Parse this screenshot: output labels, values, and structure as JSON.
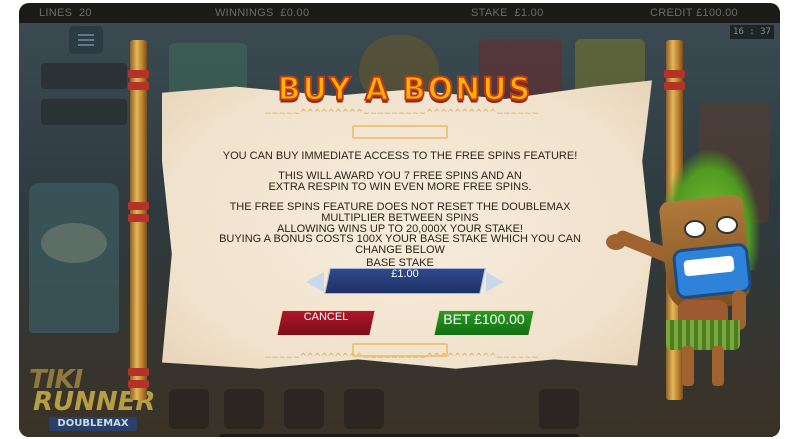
{
  "topbar": {
    "lines_label": "LINES",
    "lines_value": "20",
    "winnings_label": "WINNINGS",
    "winnings_value": "£0.00",
    "stake_label": "STAKE",
    "stake_value": "£1.00",
    "credit_label": "CREDIT",
    "credit_value": "£100.00",
    "clock": "16 : 37"
  },
  "dialog": {
    "title": "BUY A BONUS",
    "paragraphs": [
      [
        "YOU CAN BUY IMMEDIATE ACCESS TO THE FREE SPINS FEATURE!"
      ],
      [
        "THIS WILL AWARD YOU 7 FREE SPINS AND AN",
        "EXTRA RESPIN TO WIN EVEN MORE FREE SPINS."
      ],
      [
        "THE FREE SPINS FEATURE DOES NOT RESET THE DOUBLEMAX MULTIPLIER BETWEEN SPINS",
        "ALLOWING WINS UP TO 20,000X YOUR STAKE!"
      ],
      [
        "BUYING A BONUS COSTS 100X YOUR BASE STAKE WHICH YOU CAN CHANGE BELOW"
      ]
    ],
    "base_stake_label": "BASE STAKE",
    "base_stake_value": "£1.00",
    "cancel_label": "CANCEL",
    "bet_label": "BET £100.00"
  },
  "game": {
    "logo_line1": "TIKI",
    "logo_line2": "RUNNER",
    "logo_line3": "DOUBLEMAX"
  },
  "colors": {
    "title": "#ffb200",
    "cancel": "#a01424",
    "bet": "#22881c",
    "stake_box": "#243c78"
  }
}
